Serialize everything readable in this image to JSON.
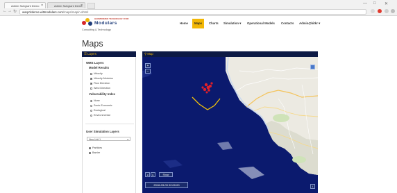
{
  "browser": {
    "tabs": [
      {
        "label": "Admin Subgrant Demo"
      },
      {
        "label": "Admin Subgrant Demo"
      }
    ],
    "url_host": "waqrcitdemo.wittmodulars.com",
    "url_path": "/maps/mapin-shtml",
    "window_controls": [
      "—",
      "□",
      "✕"
    ]
  },
  "logo": {
    "top_text": "HARMONIZED TECHNOLOGY FOR",
    "main_text": "Modulars",
    "sub_text": "Consulting & Technology"
  },
  "nav": {
    "items": [
      {
        "label": "Home"
      },
      {
        "label": "Maps"
      },
      {
        "label": "Charts"
      },
      {
        "label": "Simulation ▾"
      },
      {
        "label": "Operational Models"
      },
      {
        "label": "Contacts"
      },
      {
        "label": "Admin@bitkr ▾"
      }
    ],
    "active_index": 1
  },
  "page": {
    "title": "Maps"
  },
  "layers_panel": {
    "header": "Layers",
    "wms_title": "WMS Layers",
    "model_results_title": "Model Results",
    "model_results": [
      {
        "label": "Velocity",
        "checked": false
      },
      {
        "label": "Velocity Modulus",
        "checked": true
      },
      {
        "label": "Flow Direction",
        "checked": true
      },
      {
        "label": "Wind Direction",
        "checked": false
      }
    ],
    "vulnerability_title": "Vulnerability Index",
    "vulnerability": [
      {
        "label": "None",
        "selected": true
      },
      {
        "label": "Socio-Economic",
        "selected": false
      },
      {
        "label": "Ecological",
        "selected": false
      },
      {
        "label": "Environmental",
        "selected": false
      }
    ],
    "user_sim_title": "User Simulation Layers",
    "user_sim_select": "New Unit 1",
    "user_sim_layers": [
      {
        "label": "Particles",
        "checked": true
      },
      {
        "label": "Barrier",
        "checked": true
      }
    ]
  },
  "map_panel": {
    "header": "Map",
    "zoom_in": "+",
    "zoom_out": "−",
    "prev_label": "◂",
    "next_label": "▸",
    "show_label": "Show",
    "timestamp": "2016-03-09 02:00:00",
    "corner_label": "i"
  },
  "colors": {
    "nav_active": "#f2b705",
    "panel_header_bg": "#0d1a45",
    "panel_header_text": "#f2b705",
    "sea": "#0b1a6e",
    "land": "#eceae2",
    "barrier": "#f2c20a",
    "particles": "#e0202a"
  }
}
